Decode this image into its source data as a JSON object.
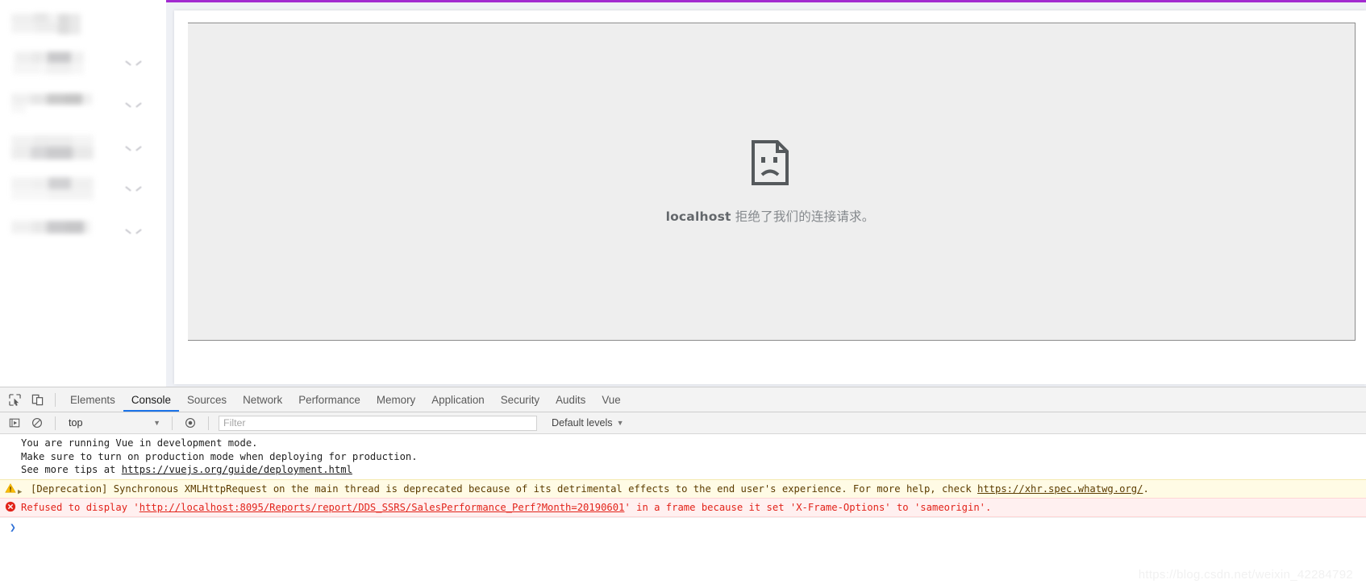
{
  "theme": {
    "accent_purple": "#a22ad0",
    "tab_active": "#1a73e8",
    "error_red": "#e2231a",
    "warn_bg": "#fffbe5",
    "error_bg": "#fff0f0"
  },
  "sidebar": {
    "items": [
      {
        "name": "logo-block",
        "redacted": true,
        "has_chevron": false
      },
      {
        "name": "nav-item-1",
        "redacted": true,
        "has_chevron": true
      },
      {
        "name": "nav-item-2",
        "redacted": true,
        "has_chevron": true
      },
      {
        "name": "nav-item-3",
        "redacted": true,
        "has_chevron": true
      },
      {
        "name": "nav-item-4",
        "redacted": true,
        "has_chevron": true
      },
      {
        "name": "nav-item-5",
        "redacted": true,
        "has_chevron": true
      }
    ]
  },
  "content": {
    "iframe_error": {
      "icon": "sad-page-icon",
      "host": "localhost",
      "message": " 拒绝了我们的连接请求。"
    }
  },
  "devtools": {
    "toolbar_icons": [
      {
        "name": "inspect-element-icon"
      },
      {
        "name": "device-toolbar-icon"
      }
    ],
    "tabs": [
      {
        "label": "Elements",
        "active": false
      },
      {
        "label": "Console",
        "active": true
      },
      {
        "label": "Sources",
        "active": false
      },
      {
        "label": "Network",
        "active": false
      },
      {
        "label": "Performance",
        "active": false
      },
      {
        "label": "Memory",
        "active": false
      },
      {
        "label": "Application",
        "active": false
      },
      {
        "label": "Security",
        "active": false
      },
      {
        "label": "Audits",
        "active": false
      },
      {
        "label": "Vue",
        "active": false
      }
    ],
    "filter_bar": {
      "execute_icon": "execute-snippet-icon",
      "clear_icon": "clear-console-icon",
      "context": "top",
      "eye_icon": "live-expression-icon",
      "filter_placeholder": "Filter",
      "filter_value": "",
      "levels_label": "Default levels"
    },
    "console": {
      "info_lines": [
        "You are running Vue in development mode.",
        "Make sure to turn on production mode when deploying for production.",
        "See more tips at "
      ],
      "info_link": "https://vuejs.org/guide/deployment.html",
      "warning": {
        "icon": "warning-triangle-icon",
        "expand_icon": "expand-arrow-icon",
        "text_before_link": "[Deprecation] Synchronous XMLHttpRequest on the main thread is deprecated because of its detrimental effects to the end user's experience. For more help, check ",
        "link": "https://xhr.spec.whatwg.org/",
        "text_after_link": "."
      },
      "error": {
        "icon": "error-circle-icon",
        "text_before_link": "Refused to display '",
        "link": "http://localhost:8095/Reports/report/DDS_SSRS/SalesPerformance_Perf?Month=20190601",
        "text_after_link": "' in a frame because it set 'X-Frame-Options' to 'sameorigin'."
      },
      "prompt_symbol": "❯"
    }
  },
  "watermark": "https://blog.csdn.net/weixin_42284792"
}
